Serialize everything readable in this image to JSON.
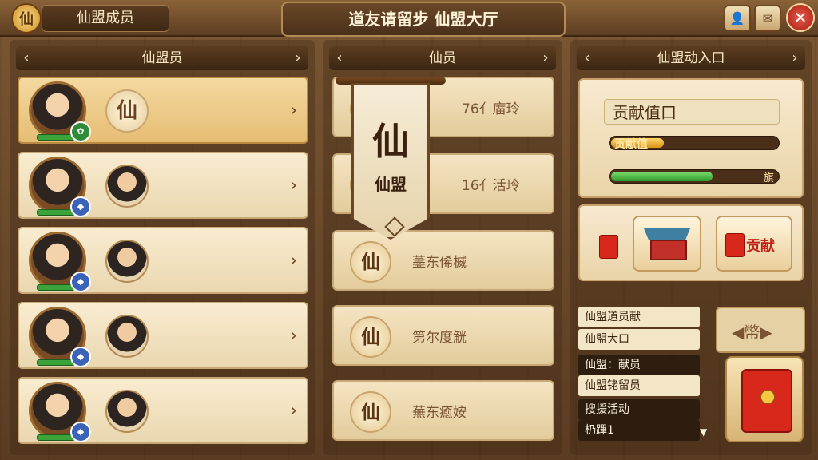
{
  "header": {
    "logo_char": "仙",
    "tab_title": "仙盟成员",
    "main_title": "道友请留步 仙盟大厅",
    "btn1_icon": "person-icon",
    "btn2_icon": "mail-icon",
    "close_label": "✕"
  },
  "left_column": {
    "title": "仙盟员",
    "members": [
      {
        "char": "仙",
        "type": "glyph"
      },
      {
        "char": "",
        "type": "avatar"
      },
      {
        "char": "",
        "type": "avatar"
      },
      {
        "char": "",
        "type": "avatar"
      },
      {
        "char": "",
        "type": "avatar"
      }
    ]
  },
  "middle_column": {
    "title": "仙员",
    "banner": {
      "big_char": "仙",
      "sub_text": "仙盟"
    },
    "items": [
      {
        "char": "民",
        "name": "76亻庿玲"
      },
      {
        "char": "民",
        "name": "16亻活玲"
      },
      {
        "char": "仙",
        "name": "藎东俙楲"
      },
      {
        "char": "仙",
        "name": "第尔度觥"
      },
      {
        "char": "仙",
        "name": "蕪东癒姲"
      }
    ]
  },
  "right_column": {
    "title": "仙盟动入口",
    "contribution_title": "贡献值口",
    "contribution_label": "贡献值",
    "contribution_level": 0.33,
    "second_bar_level": 0.62,
    "second_bar_end": "旗",
    "donate_label": "贡献",
    "bg_text": "◀幣▶"
  },
  "chat_menu": {
    "items": [
      {
        "text": "仙盟道员献",
        "style": "light"
      },
      {
        "text": "仙盟大口",
        "style": "light"
      },
      {
        "text": "仙盟：献员",
        "style": "dark"
      },
      {
        "text": "仙盟铑留员",
        "style": "light"
      },
      {
        "text": "搜援活动",
        "style": "dark"
      },
      {
        "text": "㭁蹕1",
        "style": "dark"
      }
    ],
    "dropdown_arrow": "▼"
  },
  "colors": {
    "accent_gold": "#e6bd74",
    "progress_gold": "#f0b429",
    "progress_green": "#3aa43a",
    "red_envelope": "#d8281c"
  }
}
